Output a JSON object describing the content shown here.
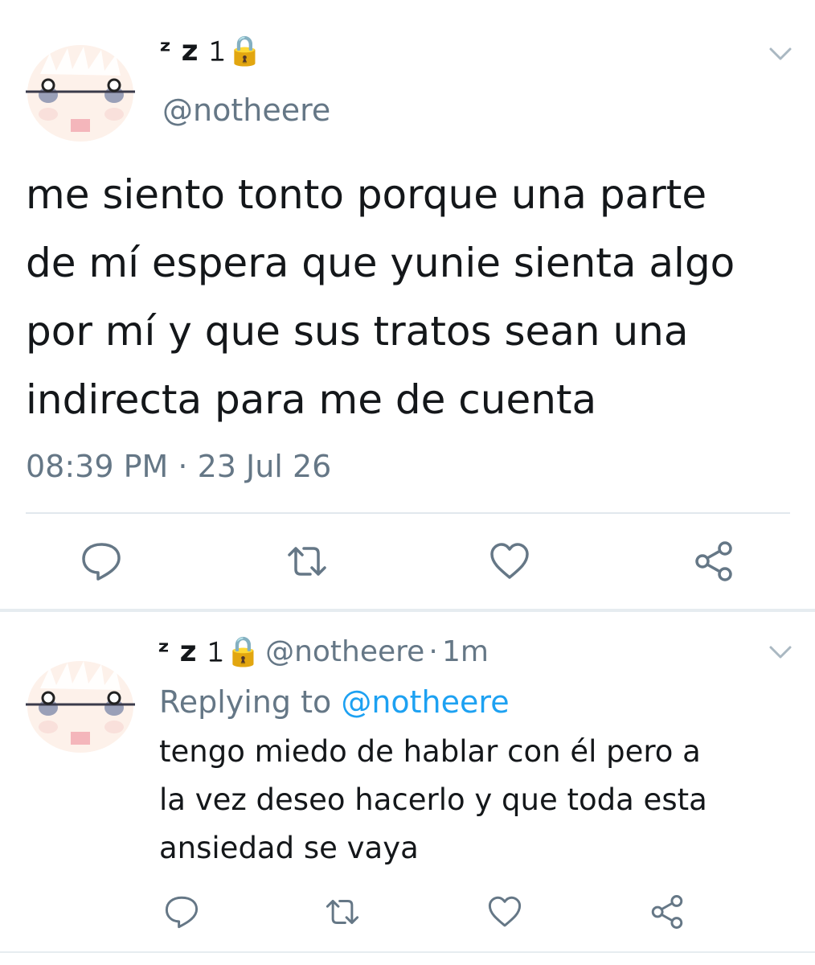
{
  "main_tweet": {
    "display_name": "ᶻ z 𝟷🔒",
    "handle": "@notheere",
    "text_lines": [
      "me siento tonto porque una parte",
      "de mí espera que yunie sienta algo",
      "por mí y que sus tratos sean una",
      "indirecta para me de cuenta"
    ],
    "time": "08:39 PM",
    "separator": "·",
    "date": "23 Jul 26"
  },
  "reply_tweet": {
    "display_name": "ᶻ z 𝟷🔒",
    "handle": "@notheere",
    "separator": "·",
    "time": "1m",
    "replying_label": "Replying to",
    "replying_handle": "@notheere",
    "text_lines": [
      "tengo miedo de hablar con él pero a",
      "la vez deseo hacerlo y que toda esta",
      "ansiedad se vaya"
    ]
  },
  "icons": {
    "avatar": "cartoon-face-avatar-icon",
    "chevron": "chevron-down-icon",
    "reply": "reply-bubble-icon",
    "retweet": "retweet-icon",
    "like": "heart-icon",
    "share": "share-icon"
  },
  "colors": {
    "text": "#14171a",
    "secondary": "#657786",
    "link": "#1da1f2",
    "divider": "#e1e8ed"
  }
}
